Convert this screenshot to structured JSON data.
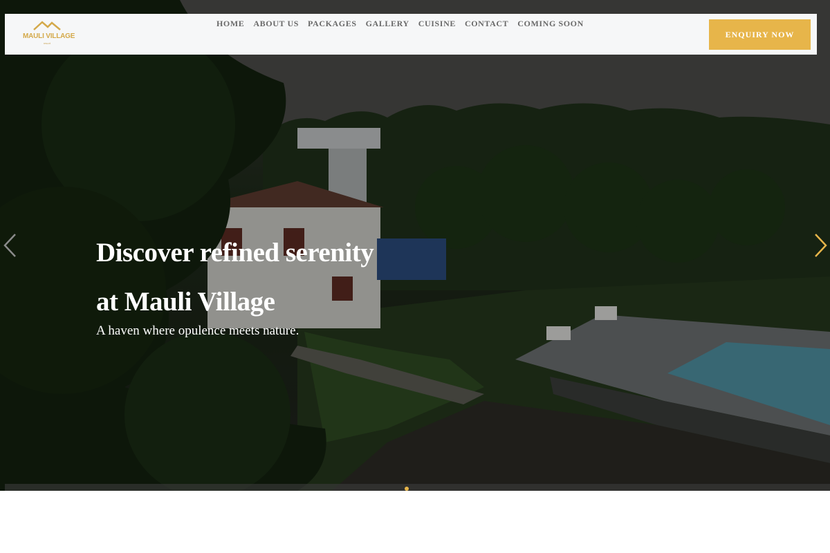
{
  "brand": {
    "name": "MAULI VILLAGE",
    "tagline": "resort",
    "accent": "#e7b54a"
  },
  "nav": {
    "items": [
      {
        "label": "HOME"
      },
      {
        "label": "ABOUT US"
      },
      {
        "label": "PACKAGES"
      },
      {
        "label": "GALLERY"
      },
      {
        "label": "CUISINE"
      },
      {
        "label": "CONTACT"
      },
      {
        "label": "COMING SOON"
      }
    ],
    "cta_label": "ENQUIRY NOW"
  },
  "hero": {
    "title_line1": "Discover refined serenity",
    "title_line2": "at Mauli Village",
    "subtitle": "A haven where opulence meets nature.",
    "prev_icon": "chevron-left-icon",
    "next_icon": "chevron-right-icon",
    "slide_count": 1,
    "active_slide": 1
  }
}
